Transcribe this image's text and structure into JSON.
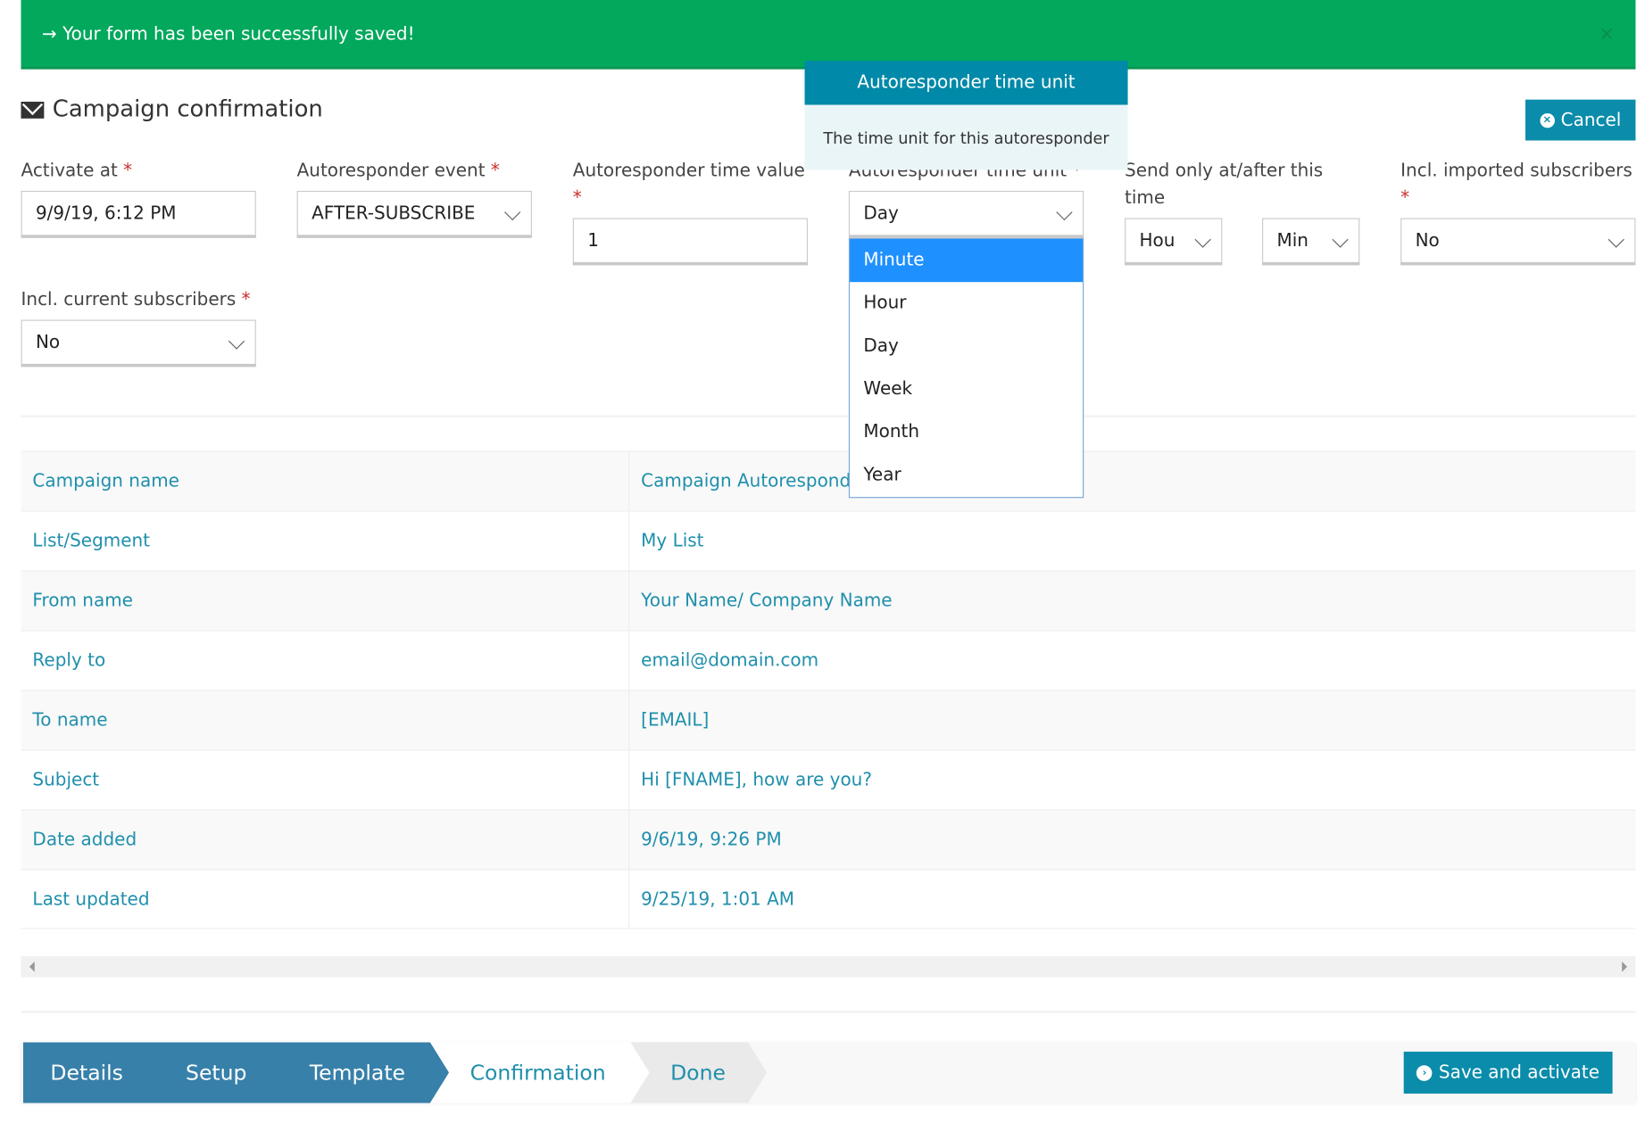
{
  "alert": {
    "message": "→ Your form has been successfully saved!",
    "close": "×"
  },
  "page": {
    "title": "Campaign confirmation",
    "cancel_label": "Cancel"
  },
  "fields": {
    "activate_at": {
      "label": "Activate at",
      "value": "9/9/19, 6:12 PM"
    },
    "event": {
      "label": "Autoresponder event",
      "value": "AFTER-SUBSCRIBE"
    },
    "time_value": {
      "label": "Autoresponder time value",
      "value": "1"
    },
    "time_unit": {
      "label": "Autoresponder time unit",
      "value": "Day",
      "options": [
        "Minute",
        "Hour",
        "Day",
        "Week",
        "Month",
        "Year"
      ],
      "highlighted": "Minute"
    },
    "send_only": {
      "label": "Send only at/after this time",
      "hour": "Hou",
      "minute": "Min"
    },
    "imported": {
      "label": "Incl. imported subscribers",
      "value": "No"
    },
    "current": {
      "label": "Incl. current subscribers",
      "value": "No"
    },
    "required_mark": "*"
  },
  "tooltip": {
    "title": "Autoresponder time unit",
    "body": "The time unit for this autoresponder"
  },
  "table": [
    {
      "key": "Campaign name",
      "value": "Campaign Autorespond"
    },
    {
      "key": "List/Segment",
      "value": "My List"
    },
    {
      "key": "From name",
      "value": "Your Name/ Company Name"
    },
    {
      "key": "Reply to",
      "value": "email@domain.com"
    },
    {
      "key": "To name",
      "value": "[EMAIL]"
    },
    {
      "key": "Subject",
      "value": "Hi [FNAME], how are you?"
    },
    {
      "key": "Date added",
      "value": "9/6/19, 9:26 PM"
    },
    {
      "key": "Last updated",
      "value": "9/25/19, 1:01 AM"
    }
  ],
  "wizard": {
    "steps": [
      "Details",
      "Setup",
      "Template",
      "Confirmation",
      "Done"
    ],
    "current": "Confirmation",
    "save_label": "Save and activate"
  },
  "colors": {
    "success": "#02a85c",
    "primary": "#0a8caa",
    "step_done": "#3780aa",
    "link": "#1f8fac",
    "option_highlight": "#1e90ff"
  }
}
